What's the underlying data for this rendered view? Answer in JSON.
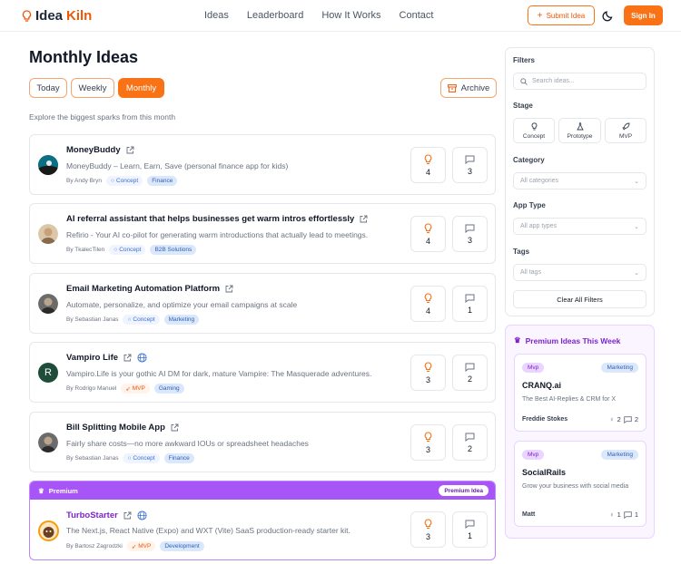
{
  "header": {
    "logo_part1": "Idea",
    "logo_part2": "Kiln",
    "nav": [
      "Ideas",
      "Leaderboard",
      "How It Works",
      "Contact"
    ],
    "submit_label": "Submit Idea",
    "signin_label": "Sign In",
    "accent_color": "#f97316"
  },
  "main": {
    "title": "Monthly Ideas",
    "tabs": [
      "Today",
      "Weekly",
      "Monthly"
    ],
    "active_tab": "Monthly",
    "archive_label": "Archive",
    "subtitle": "Explore the biggest sparks from this month"
  },
  "ideas": [
    {
      "title": "MoneyBuddy",
      "description": "MoneyBuddy – Learn, Earn, Save (personal finance app for kids)",
      "author": "By Andy Bryn",
      "stage": "Concept",
      "tag": "Finance",
      "sparks": "4",
      "comments": "3",
      "globe": false
    },
    {
      "title": "AI referral assistant that helps businesses get warm intros effortlessly",
      "description": "Refirio - Your AI co-pilot for generating warm introductions that actually lead to meetings.",
      "author": "By TkalecTilen",
      "stage": "Concept",
      "tag": "B2B Solutions",
      "sparks": "4",
      "comments": "3",
      "globe": false
    },
    {
      "title": "Email Marketing Automation Platform",
      "description": "Automate, personalize, and optimize your email campaigns at scale",
      "author": "By Sebastian Janas",
      "stage": "Concept",
      "tag": "Marketing",
      "sparks": "4",
      "comments": "1",
      "globe": false
    },
    {
      "title": "Vampiro Life",
      "description": "Vampiro.Life is your gothic AI DM for dark, mature Vampire: The Masquerade adventures.",
      "author": "By Rodrigo Manuel",
      "stage": "MVP",
      "tag": "Gaming",
      "sparks": "3",
      "comments": "2",
      "globe": true,
      "avatar_letter": "R"
    },
    {
      "title": "Bill Splitting Mobile App",
      "description": "Fairly share costs—no more awkward IOUs or spreadsheet headaches",
      "author": "By Sebastian Janas",
      "stage": "Concept",
      "tag": "Finance",
      "sparks": "3",
      "comments": "2",
      "globe": false
    }
  ],
  "premium_idea": {
    "bar_label": "Premium",
    "pill": "Premium Idea",
    "title": "TurboStarter",
    "description": "The Next.js, React Native (Expo) and WXT (Vite) SaaS production-ready starter kit.",
    "author": "By Bartosz Zagrodzki",
    "stage": "MVP",
    "tag": "Development",
    "sparks": "3",
    "comments": "1"
  },
  "filters": {
    "heading": "Filters",
    "search_placeholder": "Search ideas...",
    "stage_label": "Stage",
    "stages": [
      "Concept",
      "Prototype",
      "MVP"
    ],
    "category_label": "Category",
    "category_value": "All categories",
    "app_type_label": "App Type",
    "app_type_value": "All app types",
    "tags_label": "Tags",
    "tags_value": "All tags",
    "clear_label": "Clear All Filters"
  },
  "premium_week": {
    "heading": "Premium Ideas This Week",
    "cards": [
      {
        "stage": "Mvp",
        "tag": "Marketing",
        "title": "CRANQ.ai",
        "description": "The Best AI-Replies & CRM for X",
        "author": "Freddie Stokes",
        "sparks": "2",
        "comments": "2"
      },
      {
        "stage": "Mvp",
        "tag": "Marketing",
        "title": "SocialRails",
        "description": "Grow your business with social media",
        "author": "Matt",
        "sparks": "1",
        "comments": "1"
      }
    ]
  }
}
